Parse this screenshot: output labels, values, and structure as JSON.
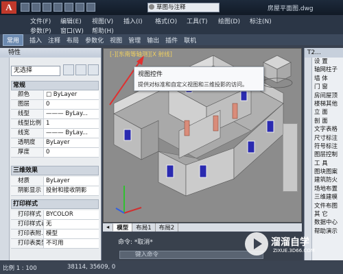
{
  "app_logo": "A",
  "workspace": "草图与注释",
  "doc_title": "房屋平面图.dwg",
  "menu": [
    "文件(F)",
    "编辑(E)",
    "视图(V)",
    "插入(I)",
    "格式(O)",
    "工具(T)",
    "绘图(D)",
    "标注(N)",
    "参数(P)",
    "窗口(W)",
    "帮助(H)"
  ],
  "ribbon_tabs": [
    "常用",
    "插入",
    "注释",
    "布局",
    "参数化",
    "视图",
    "管理",
    "输出",
    "插件",
    "联机"
  ],
  "properties": {
    "title": "特性",
    "selection": "无选择",
    "general_title": "常规",
    "general_rows": [
      {
        "k": "颜色",
        "v": "□ ByLayer"
      },
      {
        "k": "图层",
        "v": "0"
      },
      {
        "k": "线型",
        "v": "——— ByLay..."
      },
      {
        "k": "线型比例",
        "v": "1"
      },
      {
        "k": "线宽",
        "v": "——— ByLay..."
      },
      {
        "k": "透明度",
        "v": "ByLayer"
      },
      {
        "k": "厚度",
        "v": "0"
      }
    ],
    "three_d_title": "三维效果",
    "three_d_rows": [
      {
        "k": "材质",
        "v": "ByLayer"
      },
      {
        "k": "阴影显示",
        "v": "投射和接收阴影"
      }
    ],
    "print_title": "打印样式",
    "print_rows": [
      {
        "k": "打印样式",
        "v": "BYCOLOR"
      },
      {
        "k": "打印样式表",
        "v": "无"
      },
      {
        "k": "打印表附...",
        "v": "模型"
      },
      {
        "k": "打印表类型",
        "v": "不可用"
      }
    ]
  },
  "view_control": "[-][东南等轴测][X 射线]",
  "tooltip": {
    "title": "视图控件",
    "desc": "提供对标准和自定义视图和三维投影的访问。"
  },
  "layout_tabs": [
    "模型",
    "布局1",
    "布局2"
  ],
  "command": {
    "history": "命令: *取消*",
    "placeholder": "键入命令"
  },
  "status": {
    "scale": "比例 1 : 100",
    "coords": "38114, 35609, 0"
  },
  "right_panel": {
    "title": "T2...",
    "items": [
      "设 置",
      "轴网柱子",
      "墙 体",
      "门 窗",
      "房间屋顶",
      "楼梯其他",
      "立 面",
      "剖 面",
      "文字表格",
      "尺寸标注",
      "符号标注",
      "图层控制",
      "工 具",
      "图块图案",
      "建筑防火",
      "场地布置",
      "三维建模",
      "文件布图",
      "其 它",
      "数据中心",
      "帮助演示"
    ]
  },
  "watermark": {
    "name": "溜溜自学",
    "url": "ZIXUE.3D66.COM"
  },
  "colors": {
    "accent": "#6c8ab0",
    "arrow": "#e03030",
    "wall": "#cfcfcf"
  }
}
